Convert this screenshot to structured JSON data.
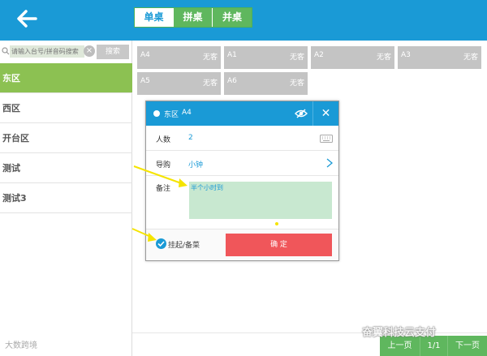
{
  "header": {
    "tabs": [
      {
        "label": "单桌"
      },
      {
        "label": "拼桌"
      },
      {
        "label": "并桌"
      }
    ]
  },
  "sidebar": {
    "search": {
      "placeholder": "请输入台号/拼音码搜索",
      "button_label": "搜索"
    },
    "areas": [
      {
        "label": "东区"
      },
      {
        "label": "西区"
      },
      {
        "label": "开台区"
      },
      {
        "label": "测试"
      },
      {
        "label": "测试3"
      }
    ]
  },
  "tables": [
    {
      "name": "A4",
      "status": "无客"
    },
    {
      "name": "A1",
      "status": "无客"
    },
    {
      "name": "A2",
      "status": "无客"
    },
    {
      "name": "A3",
      "status": "无客"
    },
    {
      "name": "A5",
      "status": "无客"
    },
    {
      "name": "A6",
      "status": "无客"
    }
  ],
  "modal": {
    "area": "东区",
    "table": "A4",
    "close_label": "✕",
    "fields": {
      "people_label": "人数",
      "people_value": "2",
      "guide_label": "导购",
      "guide_value": "小钟",
      "note_label": "备注",
      "note_value": "半个小时到"
    },
    "hold_label": "挂起/备菜",
    "confirm_label": "确 定"
  },
  "pager": {
    "prev": "上一页",
    "page": "1/1",
    "next": "下一页"
  },
  "watermarks": {
    "left": "大数跨境",
    "right": "奋翼科技云支付"
  },
  "colors": {
    "primary": "#1a9ad6",
    "green": "#5fb75e",
    "active_area": "#8cc152",
    "confirm": "#f0565a",
    "table_card": "#c4c4c4"
  }
}
